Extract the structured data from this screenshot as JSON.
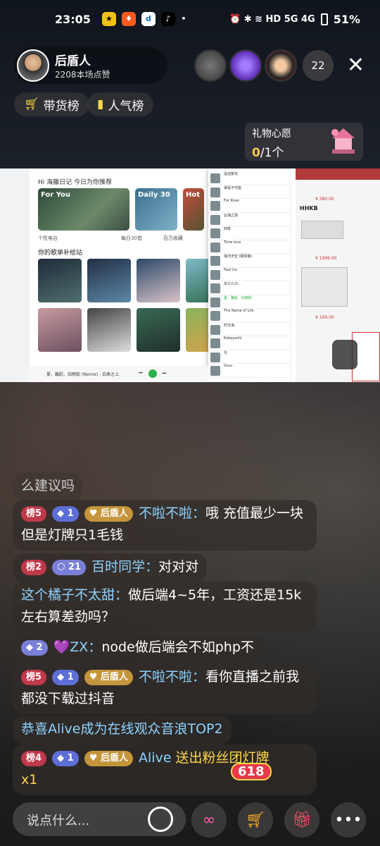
{
  "status": {
    "time": "23:05",
    "battery": "51%",
    "right_icons": "⏰ ✱ ≋ HD 5G 4G"
  },
  "host": {
    "name": "后盾人",
    "likes": "2208本场点赞"
  },
  "viewers": {
    "count": "22"
  },
  "tabs": {
    "goods": "带货榜",
    "popular": "人气榜"
  },
  "wish": {
    "title": "礼物心愿",
    "done": "0",
    "total": "/1个"
  },
  "screen": {
    "greeting": "Hi 海藤日记 今日为你推荐",
    "section": "你的歌单补给站",
    "cards": [
      "For You",
      "Daily 30",
      "Hot"
    ],
    "captions": [
      "个性电台",
      "每日30首",
      "百万收藏"
    ],
    "songs": [
      "遥远繁花",
      "谁是不可能",
      "For River",
      "云海之境",
      "四季",
      "Time love",
      "海洋天空 (钢琴版)",
      "Paul Liu",
      "あなたの...",
      "夏、蹁跹、旧雨街",
      "The Name of Life",
      "时光海",
      "Kobayashi",
      "光",
      "Vusu",
      "温水さっと",
      "My Soul",
      "JULY"
    ],
    "player": "夏、蹁跹、旧雨街 (Remix) - 白鱼之上",
    "prices": [
      "¥ 380.00",
      "¥ 1999.00",
      "¥ 169.00"
    ],
    "brand": "HHKB"
  },
  "chat": [
    {
      "id": "m0",
      "text": "么建议吗"
    },
    {
      "id": "m1",
      "rank": "榜5",
      "level": "1",
      "fan": "后盾人",
      "nick": "不啦不啦：",
      "body": "哦 充值最少一块 但是灯牌只1毛钱"
    },
    {
      "id": "m2",
      "rank": "榜2",
      "level": "21",
      "nick": "百时同学：",
      "body": "对对对"
    },
    {
      "id": "m3",
      "nick": "这个橘子不太甜：",
      "body": "做后端4~5年，工资还是15k左右算差劲吗？"
    },
    {
      "id": "m4",
      "level": "2",
      "nick": "💜ZX：",
      "body": "node做后端会不如php不"
    },
    {
      "id": "m5",
      "rank": "榜5",
      "level": "1",
      "fan": "后盾人",
      "nick": "不啦不啦：",
      "body": "看你直播之前我都没下载过抖音"
    },
    {
      "id": "m6",
      "body": "恭喜Alive成为在线观众音浪TOP2"
    },
    {
      "id": "m7",
      "rank": "榜4",
      "level": "1",
      "fan": "后盾人",
      "nick": "Alive",
      "body": " 送出粉丝团灯牌",
      "tail": "x1"
    }
  ],
  "bottom": {
    "placeholder": "说点什么...",
    "sale": "618"
  },
  "colors": {
    "accent_gold": "#ffd84a",
    "nick_blue": "#8fd3ff",
    "rank_red": "#c0394a"
  }
}
